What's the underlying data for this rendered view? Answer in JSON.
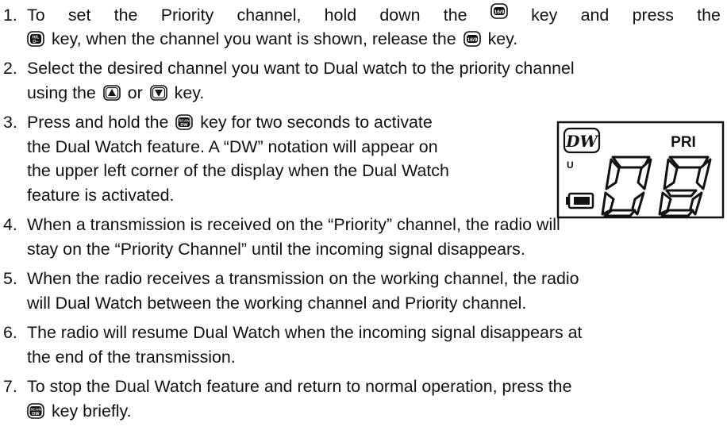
{
  "items": [
    {
      "number": "1.",
      "line1": [
        "To",
        "set",
        "the",
        "Priority",
        "channel,",
        "hold",
        "down",
        "the",
        "[KEY]",
        "key",
        "and",
        "press",
        "the"
      ],
      "line2_pre": "key, when the channel you want is shown, release the",
      "line2_post": "key."
    },
    {
      "number": "2.",
      "line1": "Select the desired channel you want to Dual watch to the priority channel",
      "line2_pre": "using the",
      "line2_mid": "or",
      "line2_post": "key."
    },
    {
      "number": "3.",
      "line1_pre": "Press and hold the",
      "line1_post": "key for two seconds to activate",
      "line2": "the Dual Watch feature. A “DW” notation will appear on",
      "line3": "the upper left corner of the display when the Dual Watch",
      "line4": "feature is activated."
    },
    {
      "number": "4.",
      "line1": "When a transmission is received on the “Priority” channel, the radio will",
      "line2": "stay on the “Priority Channel” until the incoming signal disappears."
    },
    {
      "number": "5.",
      "line1": "When the radio receives a transmission on the working channel, the radio",
      "line2": "will Dual Watch between the working channel and Priority channel."
    },
    {
      "number": "6.",
      "line1": "The radio will resume Dual Watch when the incoming signal disappears at",
      "line2": "the end of the transmission."
    },
    {
      "number": "7.",
      "line1": "To stop the Dual Watch feature and return to normal operation, press the",
      "line2_post": "key briefly."
    }
  ],
  "keys": {
    "ch16_9": "16/9",
    "hl_top": "H/L",
    "hl_bottom": "O−",
    "scan_top": "SCAN",
    "scan_bottom": "DW",
    "up": "up-arrow-key-icon",
    "down": "down-arrow-key-icon"
  },
  "lcd": {
    "mode_badge": "DW",
    "priority_label": "PRI",
    "power_indicator": "U",
    "channel": "08",
    "battery": "battery-icon"
  }
}
